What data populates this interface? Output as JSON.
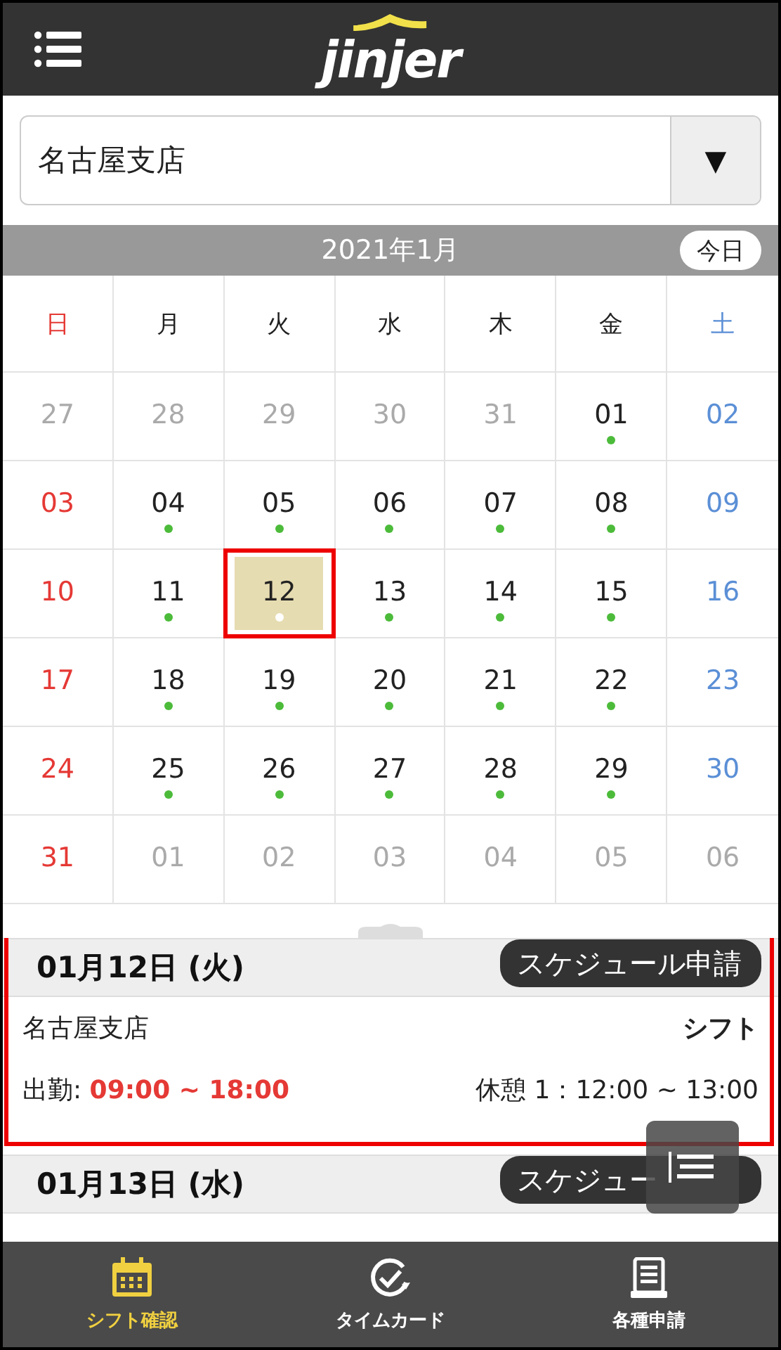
{
  "header": {
    "logo": "jinjer"
  },
  "store_select": {
    "value": "名古屋支店",
    "arrow": "▼"
  },
  "calendar": {
    "month": "2021年1月",
    "today_button": "今日",
    "weekdays": [
      "日",
      "月",
      "火",
      "水",
      "木",
      "金",
      "土"
    ],
    "weeks": [
      [
        {
          "day": "27",
          "kind": "other",
          "dot": false,
          "selected": false,
          "highlighted": false
        },
        {
          "day": "28",
          "kind": "other",
          "dot": false,
          "selected": false,
          "highlighted": false
        },
        {
          "day": "29",
          "kind": "other",
          "dot": false,
          "selected": false,
          "highlighted": false
        },
        {
          "day": "30",
          "kind": "other",
          "dot": false,
          "selected": false,
          "highlighted": false
        },
        {
          "day": "31",
          "kind": "other",
          "dot": false,
          "selected": false,
          "highlighted": false
        },
        {
          "day": "01",
          "kind": "current",
          "dot": true,
          "selected": false,
          "highlighted": false
        },
        {
          "day": "02",
          "kind": "current",
          "dot": false,
          "selected": false,
          "highlighted": false
        }
      ],
      [
        {
          "day": "03",
          "kind": "current",
          "dot": false,
          "selected": false,
          "highlighted": false
        },
        {
          "day": "04",
          "kind": "current",
          "dot": true,
          "selected": false,
          "highlighted": false
        },
        {
          "day": "05",
          "kind": "current",
          "dot": true,
          "selected": false,
          "highlighted": false
        },
        {
          "day": "06",
          "kind": "current",
          "dot": true,
          "selected": false,
          "highlighted": false
        },
        {
          "day": "07",
          "kind": "current",
          "dot": true,
          "selected": false,
          "highlighted": false
        },
        {
          "day": "08",
          "kind": "current",
          "dot": true,
          "selected": false,
          "highlighted": false
        },
        {
          "day": "09",
          "kind": "current",
          "dot": false,
          "selected": false,
          "highlighted": false
        }
      ],
      [
        {
          "day": "10",
          "kind": "current",
          "dot": false,
          "selected": false,
          "highlighted": false
        },
        {
          "day": "11",
          "kind": "current",
          "dot": true,
          "selected": false,
          "highlighted": false
        },
        {
          "day": "12",
          "kind": "current",
          "dot": true,
          "selected": true,
          "highlighted": true
        },
        {
          "day": "13",
          "kind": "current",
          "dot": true,
          "selected": false,
          "highlighted": false
        },
        {
          "day": "14",
          "kind": "current",
          "dot": true,
          "selected": false,
          "highlighted": false
        },
        {
          "day": "15",
          "kind": "current",
          "dot": true,
          "selected": false,
          "highlighted": false
        },
        {
          "day": "16",
          "kind": "current",
          "dot": false,
          "selected": false,
          "highlighted": false
        }
      ],
      [
        {
          "day": "17",
          "kind": "current",
          "dot": false,
          "selected": false,
          "highlighted": false
        },
        {
          "day": "18",
          "kind": "current",
          "dot": true,
          "selected": false,
          "highlighted": false
        },
        {
          "day": "19",
          "kind": "current",
          "dot": true,
          "selected": false,
          "highlighted": false
        },
        {
          "day": "20",
          "kind": "current",
          "dot": true,
          "selected": false,
          "highlighted": false
        },
        {
          "day": "21",
          "kind": "current",
          "dot": true,
          "selected": false,
          "highlighted": false
        },
        {
          "day": "22",
          "kind": "current",
          "dot": true,
          "selected": false,
          "highlighted": false
        },
        {
          "day": "23",
          "kind": "current",
          "dot": false,
          "selected": false,
          "highlighted": false
        }
      ],
      [
        {
          "day": "24",
          "kind": "current",
          "dot": false,
          "selected": false,
          "highlighted": false
        },
        {
          "day": "25",
          "kind": "current",
          "dot": true,
          "selected": false,
          "highlighted": false
        },
        {
          "day": "26",
          "kind": "current",
          "dot": true,
          "selected": false,
          "highlighted": false
        },
        {
          "day": "27",
          "kind": "current",
          "dot": true,
          "selected": false,
          "highlighted": false
        },
        {
          "day": "28",
          "kind": "current",
          "dot": true,
          "selected": false,
          "highlighted": false
        },
        {
          "day": "29",
          "kind": "current",
          "dot": true,
          "selected": false,
          "highlighted": false
        },
        {
          "day": "30",
          "kind": "current",
          "dot": false,
          "selected": false,
          "highlighted": false
        }
      ],
      [
        {
          "day": "31",
          "kind": "current",
          "dot": false,
          "selected": false,
          "highlighted": false
        },
        {
          "day": "01",
          "kind": "other",
          "dot": false,
          "selected": false,
          "highlighted": false
        },
        {
          "day": "02",
          "kind": "other",
          "dot": false,
          "selected": false,
          "highlighted": false
        },
        {
          "day": "03",
          "kind": "other",
          "dot": false,
          "selected": false,
          "highlighted": false
        },
        {
          "day": "04",
          "kind": "other",
          "dot": false,
          "selected": false,
          "highlighted": false
        },
        {
          "day": "05",
          "kind": "other",
          "dot": false,
          "selected": false,
          "highlighted": false
        },
        {
          "day": "06",
          "kind": "other",
          "dot": false,
          "selected": false,
          "highlighted": false
        }
      ]
    ]
  },
  "days": [
    {
      "date": "01月12日 (火)",
      "button": "スケジュール申請",
      "highlighted": true,
      "store": "名古屋支店",
      "type": "シフト",
      "work_label": "出勤: ",
      "work_time": "09:00 ~ 18:00",
      "break": "休憩 1：12:00 ~ 13:00"
    },
    {
      "date": "01月13日 (水)",
      "button": "スケジュー",
      "highlighted": false
    }
  ],
  "tabs": [
    {
      "label": "シフト確認",
      "selected": true
    },
    {
      "label": "タイムカード",
      "selected": false
    },
    {
      "label": "各種申請",
      "selected": false
    }
  ]
}
